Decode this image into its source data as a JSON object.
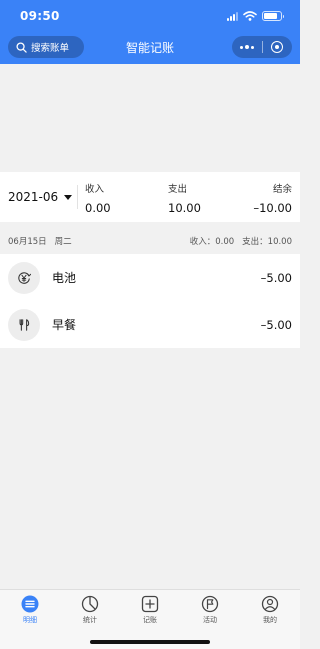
{
  "status_bar": {
    "time": "09:50"
  },
  "nav": {
    "search_label": "搜索账单",
    "title": "智能记账"
  },
  "summary": {
    "month": "2021-06",
    "income_label": "收入",
    "income_value": "0.00",
    "expense_label": "支出",
    "expense_value": "10.00",
    "balance_label": "结余",
    "balance_value": "–10.00"
  },
  "day": {
    "date": "06月15日",
    "weekday": "周二",
    "income_text": "收入：0.00",
    "expense_text": "支出：10.00",
    "entries": [
      {
        "name": "电池",
        "amount": "–5.00",
        "icon": "yen-cycle-icon"
      },
      {
        "name": "早餐",
        "amount": "–5.00",
        "icon": "fork-knife-icon"
      }
    ]
  },
  "tabs": [
    {
      "label": "明细",
      "icon": "list-icon",
      "active": true
    },
    {
      "label": "统计",
      "icon": "pie-chart-icon",
      "active": false
    },
    {
      "label": "记账",
      "icon": "add-box-icon",
      "active": false
    },
    {
      "label": "活动",
      "icon": "flag-icon",
      "active": false
    },
    {
      "label": "我的",
      "icon": "profile-icon",
      "active": false
    }
  ],
  "colors": {
    "accent": "#3a82f7",
    "background": "#f1f1f1"
  }
}
